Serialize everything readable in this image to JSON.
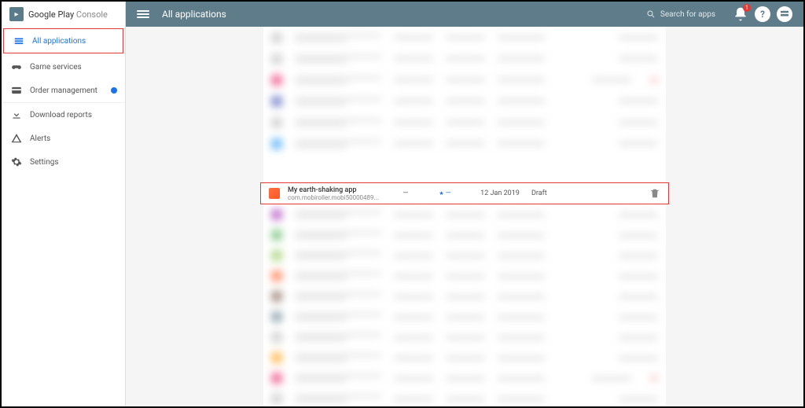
{
  "brand": {
    "name": "Google Play",
    "suffix": "Console"
  },
  "topbar": {
    "title": "All applications",
    "search_placeholder": "Search for apps",
    "notification_count": "1"
  },
  "sidebar": {
    "items": [
      {
        "label": "All applications",
        "icon": "apps"
      },
      {
        "label": "Game services",
        "icon": "gamepad"
      },
      {
        "label": "Order management",
        "icon": "card",
        "badge": true
      },
      {
        "label": "Download reports",
        "icon": "download"
      },
      {
        "label": "Alerts",
        "icon": "alert"
      },
      {
        "label": "Settings",
        "icon": "gear"
      }
    ]
  },
  "focused_row": {
    "name": "My earth-shaking app",
    "package": "com.mobiroller.mobi50000489...",
    "installs": "—",
    "rating": "—",
    "updated": "12 Jan 2019",
    "status": "Draft"
  }
}
